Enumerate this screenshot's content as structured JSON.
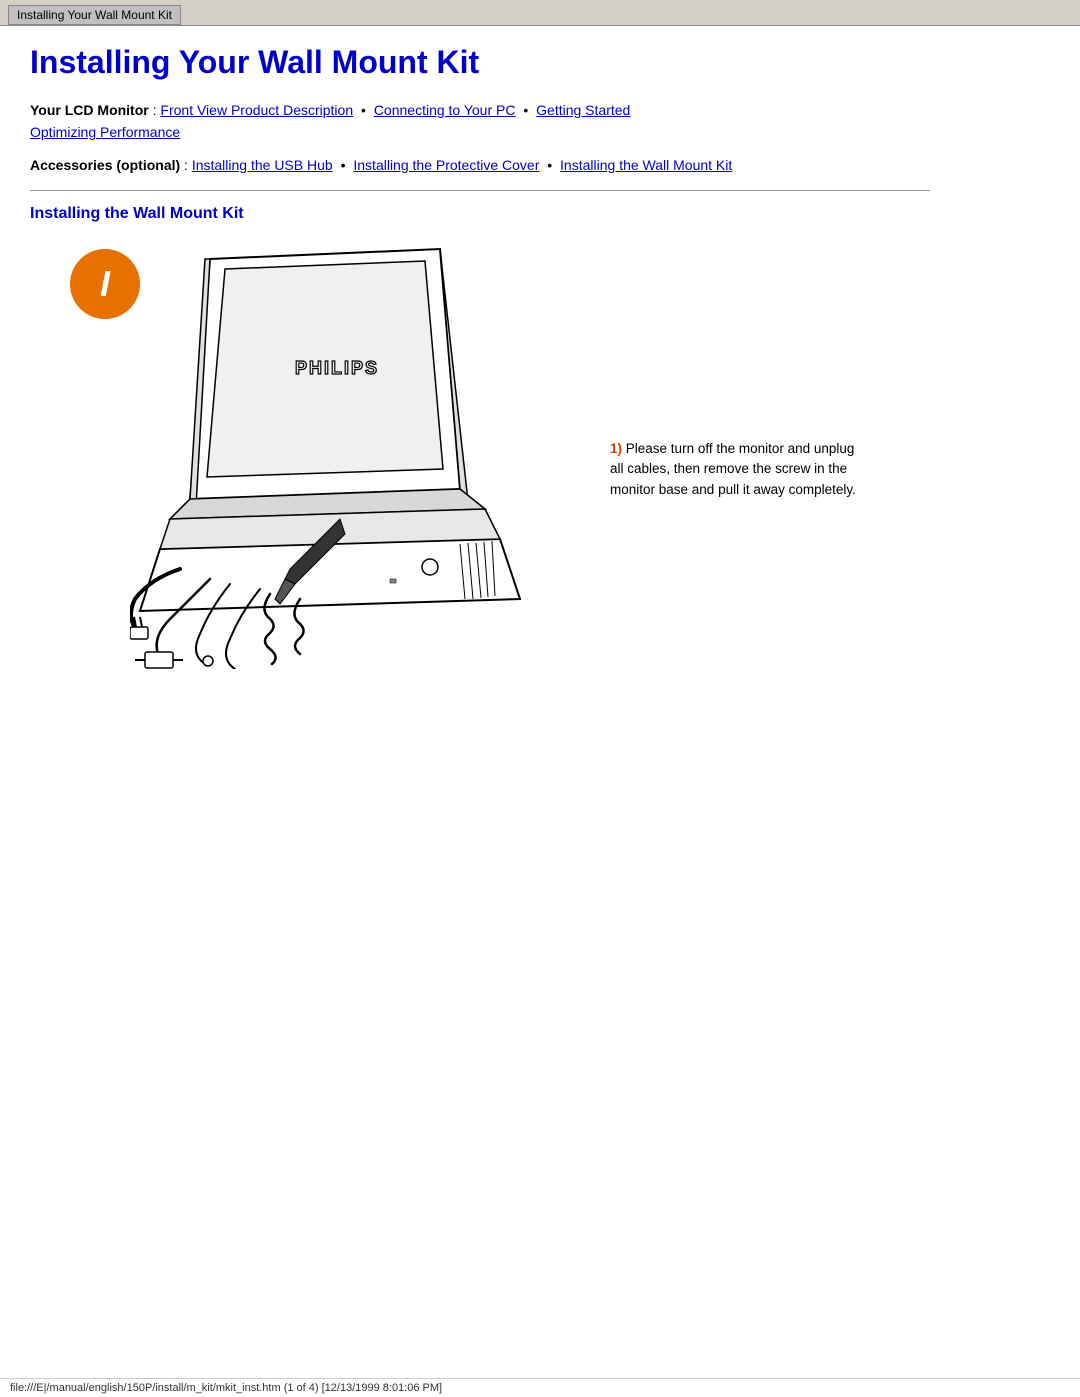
{
  "tab": {
    "title": "Installing Your Wall Mount Kit"
  },
  "page": {
    "title": "Installing Your Wall Mount Kit",
    "nav_your_lcd_label": "Your LCD Monitor",
    "nav_accessories_label": "Accessories (optional)",
    "nav_links_lcd": [
      {
        "label": "Front View Product Description",
        "href": "#"
      },
      {
        "label": "Connecting to Your PC",
        "href": "#"
      },
      {
        "label": "Getting Started",
        "href": "#"
      },
      {
        "label": "Optimizing Performance",
        "href": "#"
      }
    ],
    "nav_links_accessories": [
      {
        "label": "Installing the USB Hub",
        "href": "#"
      },
      {
        "label": "Installing the Protective Cover",
        "href": "#"
      },
      {
        "label": "Installing the Wall Mount Kit",
        "href": "#"
      }
    ],
    "section_heading": "Installing the Wall Mount Kit",
    "step_badge_letter": "I",
    "step_number": "1)",
    "step_description": "Please turn off the monitor and unplug all cables, then remove the screw in the monitor base and pull it away completely."
  },
  "footer": {
    "text": "file:///E|/manual/english/150P/install/m_kit/mkit_inst.htm (1 of 4) [12/13/1999 8:01:06 PM]"
  }
}
